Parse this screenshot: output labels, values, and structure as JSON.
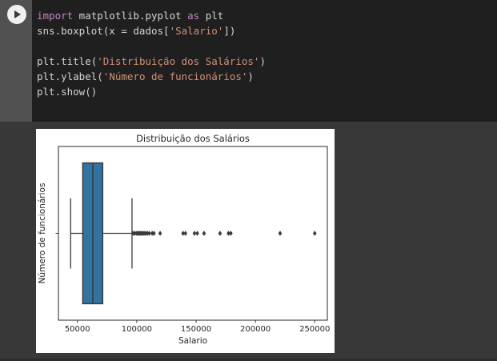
{
  "page": {
    "background": "#383838"
  },
  "code_cell": {
    "run_button_icon": "play-icon",
    "syntax_colors": {
      "keyword": "#c586c0",
      "string": "#ce9178",
      "plain": "#d4d4d4",
      "background": "#1f1f1f",
      "gutter": "#515151"
    },
    "lines": [
      [
        {
          "t": "import",
          "c": "kw"
        },
        {
          "t": " matplotlib.pyplot ",
          "c": "pl"
        },
        {
          "t": "as",
          "c": "kw"
        },
        {
          "t": " plt",
          "c": "pl"
        }
      ],
      [
        {
          "t": "sns.boxplot(x = dados[",
          "c": "pl"
        },
        {
          "t": "'Salario'",
          "c": "str"
        },
        {
          "t": "])",
          "c": "pl"
        }
      ],
      [],
      [
        {
          "t": "plt.title(",
          "c": "pl"
        },
        {
          "t": "'Distribuição dos Salários'",
          "c": "str"
        },
        {
          "t": ")",
          "c": "pl"
        }
      ],
      [
        {
          "t": "plt.ylabel(",
          "c": "pl"
        },
        {
          "t": "'Número de funcionários'",
          "c": "str"
        },
        {
          "t": ")",
          "c": "pl"
        }
      ],
      [
        {
          "t": "plt.show()",
          "c": "pl"
        }
      ]
    ]
  },
  "chart_data": {
    "type": "boxplot",
    "orientation": "horizontal",
    "title": "Distribuição dos Salários",
    "xlabel": "Salario",
    "ylabel": "Número de funcionários",
    "xlim": [
      34000,
      260600
    ],
    "xticks": [
      50000,
      100000,
      150000,
      200000,
      250000
    ],
    "grid": false,
    "legend": null,
    "box": {
      "whisker_low": 44300,
      "q1": 54500,
      "median": 63000,
      "q3": 71300,
      "whisker_high": 96000
    },
    "outliers": [
      97000,
      98500,
      100000,
      101000,
      102000,
      103000,
      104000,
      105000,
      106200,
      107500,
      109000,
      110500,
      113000,
      114500,
      119700,
      139000,
      141000,
      148600,
      151000,
      156700,
      170200,
      177300,
      179300,
      220800,
      250000
    ],
    "colors": {
      "box_fill": "#3274a1",
      "line": "#3a3a3a",
      "text": "#262626",
      "spine": "#262626",
      "figure_bg": "#ffffff"
    }
  }
}
